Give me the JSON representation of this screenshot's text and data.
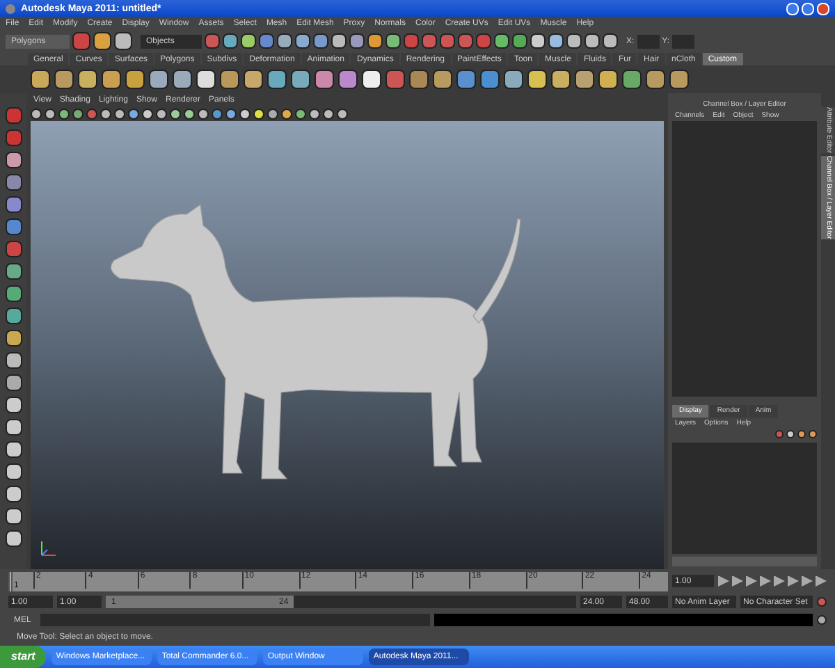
{
  "window": {
    "title": "Autodesk Maya 2011: untitled*"
  },
  "menu_bar": [
    "File",
    "Edit",
    "Modify",
    "Create",
    "Display",
    "Window",
    "Assets",
    "Select",
    "Mesh",
    "Edit Mesh",
    "Proxy",
    "Normals",
    "Color",
    "Create UVs",
    "Edit UVs",
    "Muscle",
    "Help"
  ],
  "status_line": {
    "menu_set": "Polygons",
    "selection_field": "Objects",
    "x_label": "X:",
    "y_label": "Y:"
  },
  "shelf_tabs": [
    {
      "label": "General",
      "selected": false
    },
    {
      "label": "Curves",
      "selected": false
    },
    {
      "label": "Surfaces",
      "selected": false
    },
    {
      "label": "Polygons",
      "selected": false
    },
    {
      "label": "Subdivs",
      "selected": false
    },
    {
      "label": "Deformation",
      "selected": false
    },
    {
      "label": "Animation",
      "selected": false
    },
    {
      "label": "Dynamics",
      "selected": false
    },
    {
      "label": "Rendering",
      "selected": false
    },
    {
      "label": "PaintEffects",
      "selected": false
    },
    {
      "label": "Toon",
      "selected": false
    },
    {
      "label": "Muscle",
      "selected": false
    },
    {
      "label": "Fluids",
      "selected": false
    },
    {
      "label": "Fur",
      "selected": false
    },
    {
      "label": "Hair",
      "selected": false
    },
    {
      "label": "nCloth",
      "selected": false
    },
    {
      "label": "Custom",
      "selected": true
    }
  ],
  "viewport": {
    "menu": [
      "View",
      "Shading",
      "Lighting",
      "Show",
      "Renderer",
      "Panels"
    ]
  },
  "channel_box": {
    "title": "Channel Box / Layer Editor",
    "menu": [
      "Channels",
      "Edit",
      "Object",
      "Show"
    ]
  },
  "layer_editor": {
    "tabs": [
      {
        "label": "Display",
        "selected": true
      },
      {
        "label": "Render",
        "selected": false
      },
      {
        "label": "Anim",
        "selected": false
      }
    ],
    "menu": [
      "Layers",
      "Options",
      "Help"
    ]
  },
  "side_tabs": [
    {
      "label": "Attribute Editor",
      "selected": false
    },
    {
      "label": "Channel Box / Layer Editor",
      "selected": true
    }
  ],
  "time_slider": {
    "ticks": [
      "2",
      "4",
      "6",
      "8",
      "10",
      "12",
      "14",
      "16",
      "18",
      "20",
      "22",
      "24"
    ],
    "current_frame": "1",
    "level": 0,
    "current_time": "1.00"
  },
  "range_slider": {
    "start_time": "1.00",
    "playback_start": "1.00",
    "range_start": "1",
    "range_end": "24",
    "playback_end": "24.00",
    "end_time": "48.00",
    "anim_layer": "No Anim Layer",
    "character_set": "No Character Set"
  },
  "command_line": {
    "label": "MEL"
  },
  "help_line": "Move Tool: Select an object to move.",
  "taskbar": {
    "start": "start",
    "items": [
      {
        "label": "Windows Marketplace...",
        "selected": false
      },
      {
        "label": "Total Commander 6.0...",
        "selected": false
      },
      {
        "label": "Output Window",
        "selected": false
      },
      {
        "label": "Autodesk Maya 2011...",
        "selected": true
      }
    ]
  }
}
